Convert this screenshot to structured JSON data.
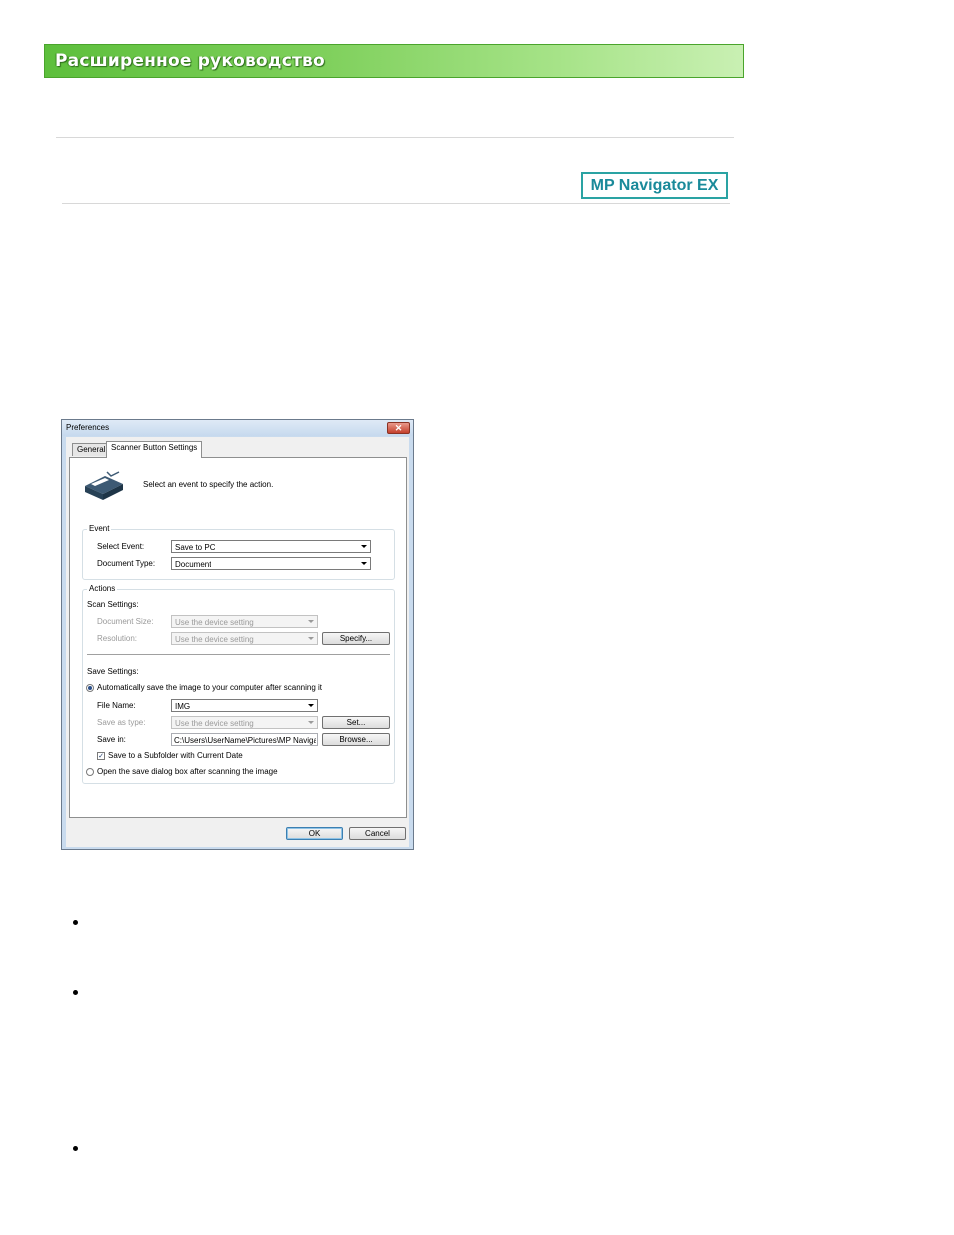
{
  "banner": {
    "title": "Расширенное руководство"
  },
  "logo": {
    "text": "MP Navigator EX"
  },
  "dialog": {
    "title": "Preferences",
    "close_label": "✕",
    "tabs": [
      "General",
      "Scanner Button Settings"
    ],
    "intro": "Select an event to specify the action.",
    "event": {
      "group_label": "Event",
      "select_event_label": "Select Event:",
      "select_event_value": "Save to PC",
      "document_type_label": "Document Type:",
      "document_type_value": "Document"
    },
    "actions": {
      "group_label": "Actions",
      "scan_settings_label": "Scan Settings:",
      "document_size_label": "Document Size:",
      "document_size_value": "Use the device setting",
      "resolution_label": "Resolution:",
      "resolution_value": "Use the device setting",
      "specify_button": "Specify...",
      "save_settings_label": "Save Settings:",
      "auto_save_radio": "Automatically save the image to your computer after scanning it",
      "file_name_label": "File Name:",
      "file_name_value": "IMG",
      "save_as_type_label": "Save as type:",
      "save_as_type_value": "Use the device setting",
      "set_button": "Set...",
      "save_in_label": "Save in:",
      "save_in_value": "C:\\Users\\UserName\\Pictures\\MP Navigato",
      "browse_button": "Browse...",
      "subfolder_checkbox": "Save to a Subfolder with Current Date",
      "open_dialog_radio": "Open the save dialog box after scanning the image"
    },
    "ok_button": "OK",
    "cancel_button": "Cancel"
  }
}
